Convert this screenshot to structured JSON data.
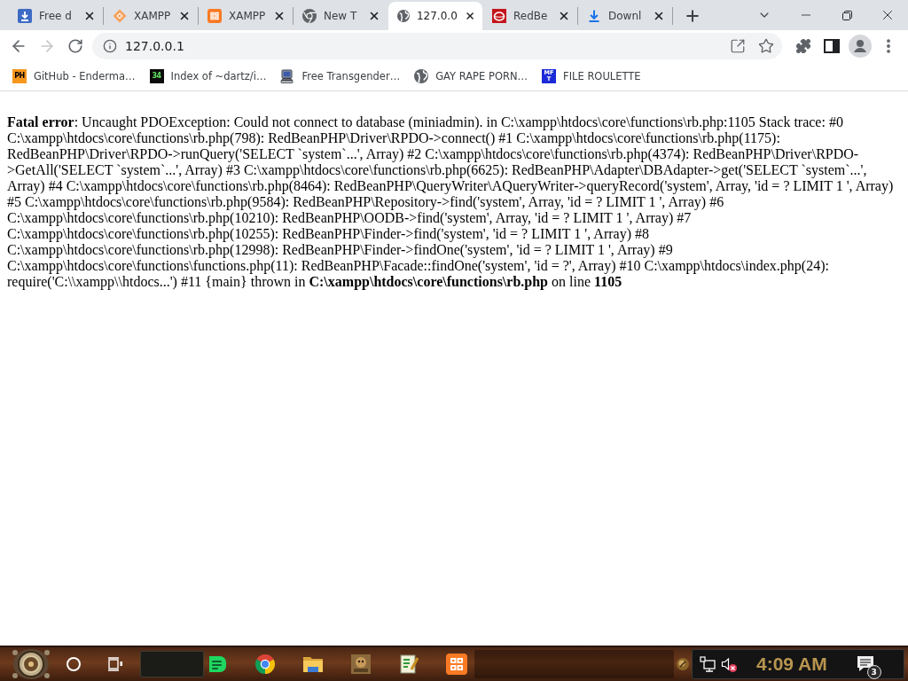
{
  "tabs": [
    {
      "title": "Free d",
      "selected": false
    },
    {
      "title": "XAMPP",
      "selected": false
    },
    {
      "title": "XAMPP",
      "selected": false
    },
    {
      "title": "New T",
      "selected": false
    },
    {
      "title": "127.0.0",
      "selected": true
    },
    {
      "title": "RedBe",
      "selected": false
    },
    {
      "title": "Downl",
      "selected": false
    }
  ],
  "toolbar": {
    "forward_disabled": true,
    "url": "127.0.0.1"
  },
  "bookmarks": [
    {
      "badge": "PH",
      "title": "GitHub - Enderma…"
    },
    {
      "badge": "34",
      "title": "Index of ~dartz/i…"
    },
    {
      "title": "Free Transgender…"
    },
    {
      "title": "GAY RAPE PORN…"
    },
    {
      "badge": "MFT",
      "title": "FILE ROULETTE"
    }
  ],
  "page": {
    "error_message": "**Fatal error**: Uncaught PDOException: Could not connect to database (miniadmin). in C:\\xampp\\htdocs\\core\\functions\\rb.php:1105 Stack trace: #0 C:\\xampp\\htdocs\\core\\functions\\rb.php(798): RedBeanPHP\\Driver\\RPDO->connect() #1 C:\\xampp\\htdocs\\core\\functions\\rb.php(1175): RedBeanPHP\\Driver\\RPDO->runQuery('SELECT `system`...', Array) #2 C:\\xampp\\htdocs\\core\\functions\\rb.php(4374): RedBeanPHP\\Driver\\RPDO->GetAll('SELECT `system`...', Array) #3 C:\\xampp\\htdocs\\core\\functions\\rb.php(6625): RedBeanPHP\\Adapter\\DBAdapter->get('SELECT `system`...', Array) #4 C:\\xampp\\htdocs\\core\\functions\\rb.php(8464): RedBeanPHP\\QueryWriter\\AQueryWriter->queryRecord('system', Array, 'id = ? LIMIT 1 ', Array) #5 C:\\xampp\\htdocs\\core\\functions\\rb.php(9584): RedBeanPHP\\Repository->find('system', Array, 'id = ? LIMIT 1 ', Array) #6 C:\\xampp\\htdocs\\core\\functions\\rb.php(10210): RedBeanPHP\\OODB->find('system', Array, 'id = ? LIMIT 1 ', Array) #7 C:\\xampp\\htdocs\\core\\functions\\rb.php(10255): RedBeanPHP\\Finder->find('system', 'id = ? LIMIT 1 ', Array) #8 C:\\xampp\\htdocs\\core\\functions\\rb.php(12998): RedBeanPHP\\Finder->findOne('system', 'id = ? LIMIT 1 ', Array) #9 C:\\xampp\\htdocs\\core\\functions\\functions.php(11): RedBeanPHP\\Facade::findOne('system', 'id = ?', Array) #10 C:\\xampp\\htdocs\\index.php(24): require('C:\\\\xampp\\\\htdocs...') #11 {main} thrown in **C:\\xampp\\htdocs\\core\\functions\\rb.php** on line **1105**"
  },
  "taskbar": {
    "volume_muted": true,
    "clock": "4:09 AM",
    "notification_count": "3"
  }
}
